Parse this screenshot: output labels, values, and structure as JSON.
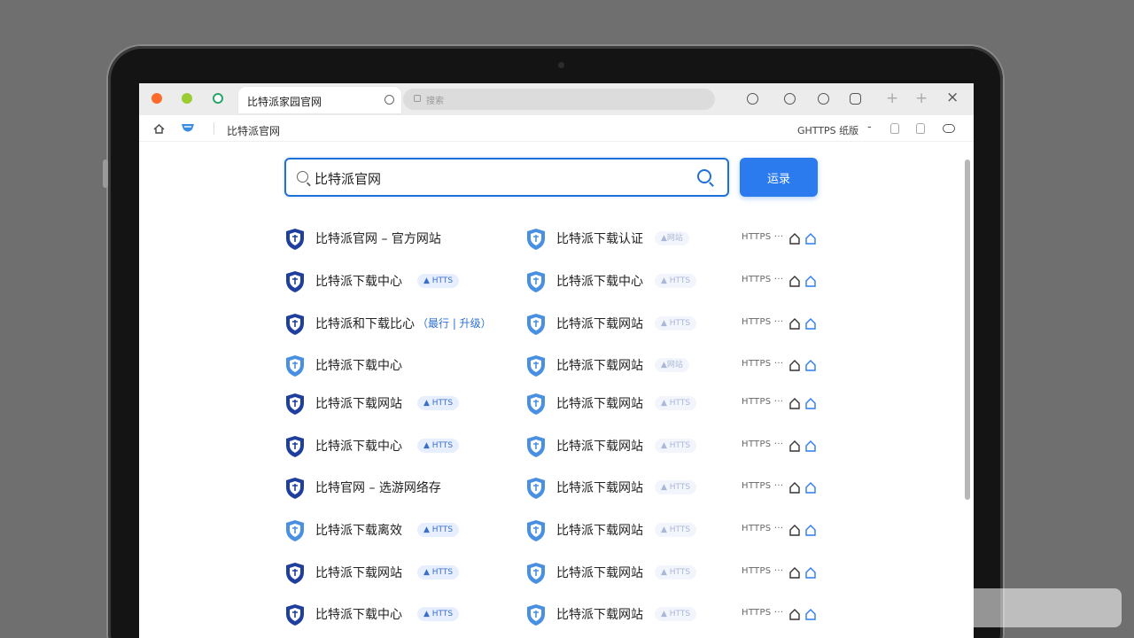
{
  "window": {
    "tab_title": "比特派家园官网",
    "address": "搜索",
    "toolbar_page_label": "比特派官网",
    "toolbar_right_label": "GHTTPS 纸版",
    "toolbar_dash": "-"
  },
  "search": {
    "value": "比特派官网",
    "button_label": "运录"
  },
  "colors": {
    "accent": "#2b7bef",
    "shield_dark": "#1f3f9e",
    "shield_light": "#4a90e2"
  },
  "results": [
    {
      "left": {
        "title": "比特派官网 – 官方网站",
        "badge": "",
        "note": "",
        "shield": "dark"
      },
      "right": {
        "title": "比特派下载认证",
        "badge": "▲网站",
        "shield": "light"
      },
      "status": "HTTPS ···"
    },
    {
      "left": {
        "title": "比特派下载中心",
        "badge": "▲ HTTS",
        "note": "",
        "shield": "dark"
      },
      "right": {
        "title": "比特派下载中心",
        "badge": "▲ HTTS",
        "shield": "light"
      },
      "status": "HTTPS ···"
    },
    {
      "left": {
        "title": "比特派和下载比心",
        "badge": "",
        "note": "（最行 | 升级）",
        "shield": "dark"
      },
      "right": {
        "title": "比特派下载网站",
        "badge": "▲ HTTS",
        "shield": "light"
      },
      "status": "HTTPS ···"
    },
    {
      "left": {
        "title": "比特派下载中心",
        "badge": "",
        "note": "",
        "shield": "light"
      },
      "right": {
        "title": "比特派下载网站",
        "badge": "▲网站",
        "shield": "light"
      },
      "status": "HTTPS ···"
    },
    {
      "left": {
        "title": "比特派下载网站",
        "badge": "▲ HTTS",
        "note": "",
        "shield": "dark"
      },
      "right": {
        "title": "比特派下载网站",
        "badge": "▲ HTTS",
        "shield": "light"
      },
      "status": "HTTPS ···"
    },
    {
      "left": {
        "title": "比特派下载中心",
        "badge": "▲ HTTS",
        "note": "",
        "shield": "dark"
      },
      "right": {
        "title": "比特派下载网站",
        "badge": "▲ HTTS",
        "shield": "light"
      },
      "status": "HTTPS ···"
    },
    {
      "left": {
        "title": "比特官网 – 选游网络存",
        "badge": "",
        "note": "",
        "shield": "dark"
      },
      "right": {
        "title": "比特派下载网站",
        "badge": "▲ HTTS",
        "shield": "light"
      },
      "status": "HTTPS ···"
    },
    {
      "left": {
        "title": "比特派下载离效",
        "badge": "▲ HTTS",
        "note": "",
        "shield": "light"
      },
      "right": {
        "title": "比特派下载网站",
        "badge": "▲ HTTS",
        "shield": "light"
      },
      "status": "HTTPS ···"
    },
    {
      "left": {
        "title": "比特派下载网站",
        "badge": "▲ HTTS",
        "note": "",
        "shield": "dark"
      },
      "right": {
        "title": "比特派下载网站",
        "badge": "▲ HTTS",
        "shield": "light"
      },
      "status": "HTTPS ···"
    },
    {
      "left": {
        "title": "比特派下载中心",
        "badge": "▲ HTTS",
        "note": "",
        "shield": "dark"
      },
      "right": {
        "title": "比特派下载网站",
        "badge": "▲ HTTS",
        "shield": "light"
      },
      "status": "HTTPS ···"
    }
  ]
}
